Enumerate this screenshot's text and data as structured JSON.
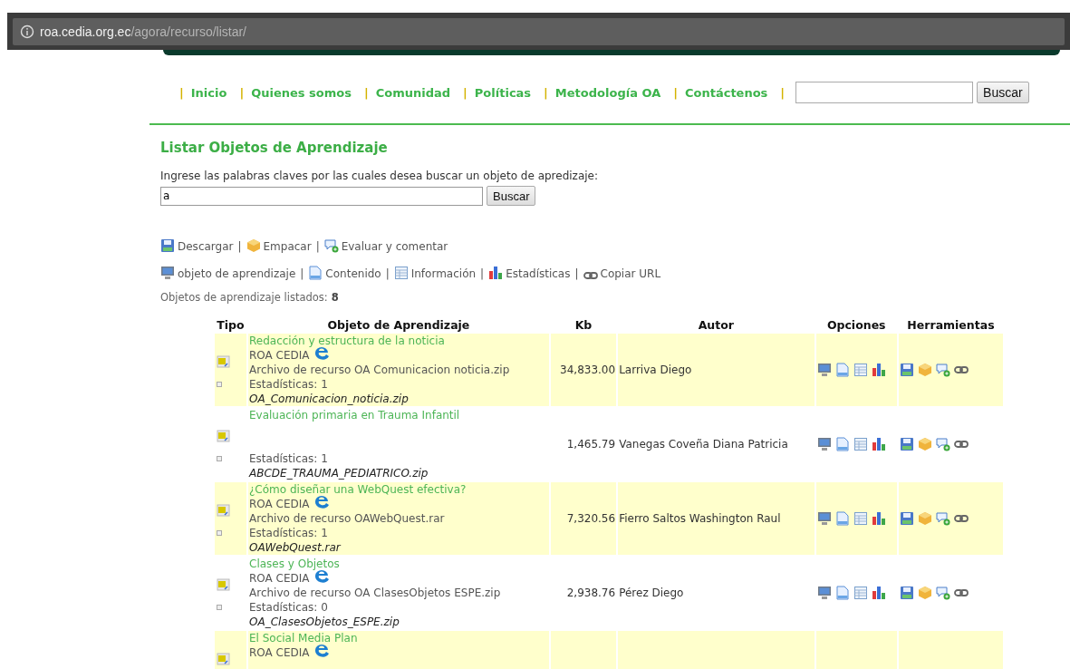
{
  "browser": {
    "url_host": "roa.cedia.org.ec",
    "url_path": "/agora/recurso/listar/"
  },
  "nav": {
    "items": [
      "Inicio",
      "Quienes somos",
      "Comunidad",
      "Políticas",
      "Metodología OA",
      "Contáctenos"
    ],
    "separator": "|",
    "search_button": "Buscar"
  },
  "page": {
    "title": "Listar Objetos de Aprendizaje",
    "prompt": "Ingrese las palabras claves por las cuales desea buscar un objeto de apredizaje:",
    "search_value": "a",
    "search_button": "Buscar"
  },
  "tool_legend": [
    {
      "kind": "save",
      "label": "Descargar"
    },
    {
      "kind": "package",
      "label": "Empacar"
    },
    {
      "kind": "comment",
      "label": "Evaluar y comentar"
    }
  ],
  "option_legend": [
    {
      "kind": "monitor",
      "label": "objeto de aprendizaje"
    },
    {
      "kind": "document",
      "label": "Contenido"
    },
    {
      "kind": "table",
      "label": "Información"
    },
    {
      "kind": "chart",
      "label": "Estadísticas"
    },
    {
      "kind": "link",
      "label": "Copiar URL"
    }
  ],
  "legend_separator": "|",
  "count": {
    "label": "Objetos de aprendizaje listados:",
    "value": "8"
  },
  "table": {
    "columns": [
      "Tipo",
      "Objeto de Aprendizaje",
      "Kb",
      "Autor",
      "Opciones",
      "Herramientas"
    ],
    "rows": [
      {
        "title": "Redacción y estructura de la noticia",
        "source": "ROA CEDIA",
        "archive": "Archivo de recurso OA Comunicacion noticia.zip",
        "stats": "Estadísticas: 1",
        "file": "OA_Comunicacion_noticia.zip",
        "kb": "34,833.00",
        "author": "Larriva Diego"
      },
      {
        "title": "Evaluación primaria en Trauma Infantil",
        "stats": "Estadísticas: 1",
        "file": "ABCDE_TRAUMA_PEDIATRICO.zip",
        "kb": "1,465.79",
        "author": "Vanegas Coveña Diana Patricia"
      },
      {
        "title": "¿Cómo diseñar una WebQuest efectiva?",
        "source": "ROA CEDIA",
        "archive": "Archivo de recurso OAWebQuest.rar",
        "stats": "Estadísticas: 1",
        "file": "OAWebQuest.rar",
        "kb": "7,320.56",
        "author": "Fierro Saltos Washington Raul"
      },
      {
        "title": "Clases y Objetos",
        "source": "ROA CEDIA",
        "archive": "Archivo de recurso OA ClasesObjetos ESPE.zip",
        "stats": "Estadísticas: 0",
        "file": "OA_ClasesObjetos_ESPE.zip",
        "kb": "2,938.76",
        "author": "Pérez Diego"
      },
      {
        "title": "El Social Media Plan",
        "source": "ROA CEDIA"
      }
    ]
  }
}
